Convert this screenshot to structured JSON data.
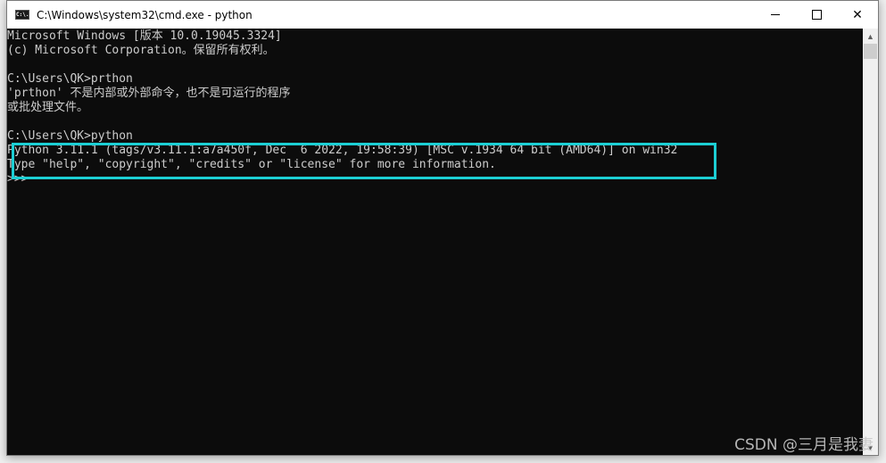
{
  "window": {
    "title": "C:\\Windows\\system32\\cmd.exe - python",
    "icon": "cmd-icon",
    "icon_text": "C:\\.",
    "controls": {
      "minimize": "minimize-icon",
      "maximize": "maximize-icon",
      "close_glyph": "✕"
    }
  },
  "console": {
    "lines": [
      "Microsoft Windows [版本 10.0.19045.3324]",
      "(c) Microsoft Corporation。保留所有权利。",
      "",
      "C:\\Users\\QK>prthon",
      "'prthon' 不是内部或外部命令，也不是可运行的程序",
      "或批处理文件。",
      "",
      "C:\\Users\\QK>python",
      "Python 3.11.1 (tags/v3.11.1:a7a450f, Dec  6 2022, 19:58:39) [MSC v.1934 64 bit (AMD64)] on win32",
      "Type \"help\", \"copyright\", \"credits\" or \"license\" for more information.",
      ">>> "
    ],
    "highlight_color": "#1ccfd4",
    "text_color": "#cccccc",
    "background": "#0c0c0c"
  },
  "scrollbar": {
    "up_glyph": "▲",
    "down_glyph": "▼"
  },
  "watermark": "CSDN @三月是我妻"
}
